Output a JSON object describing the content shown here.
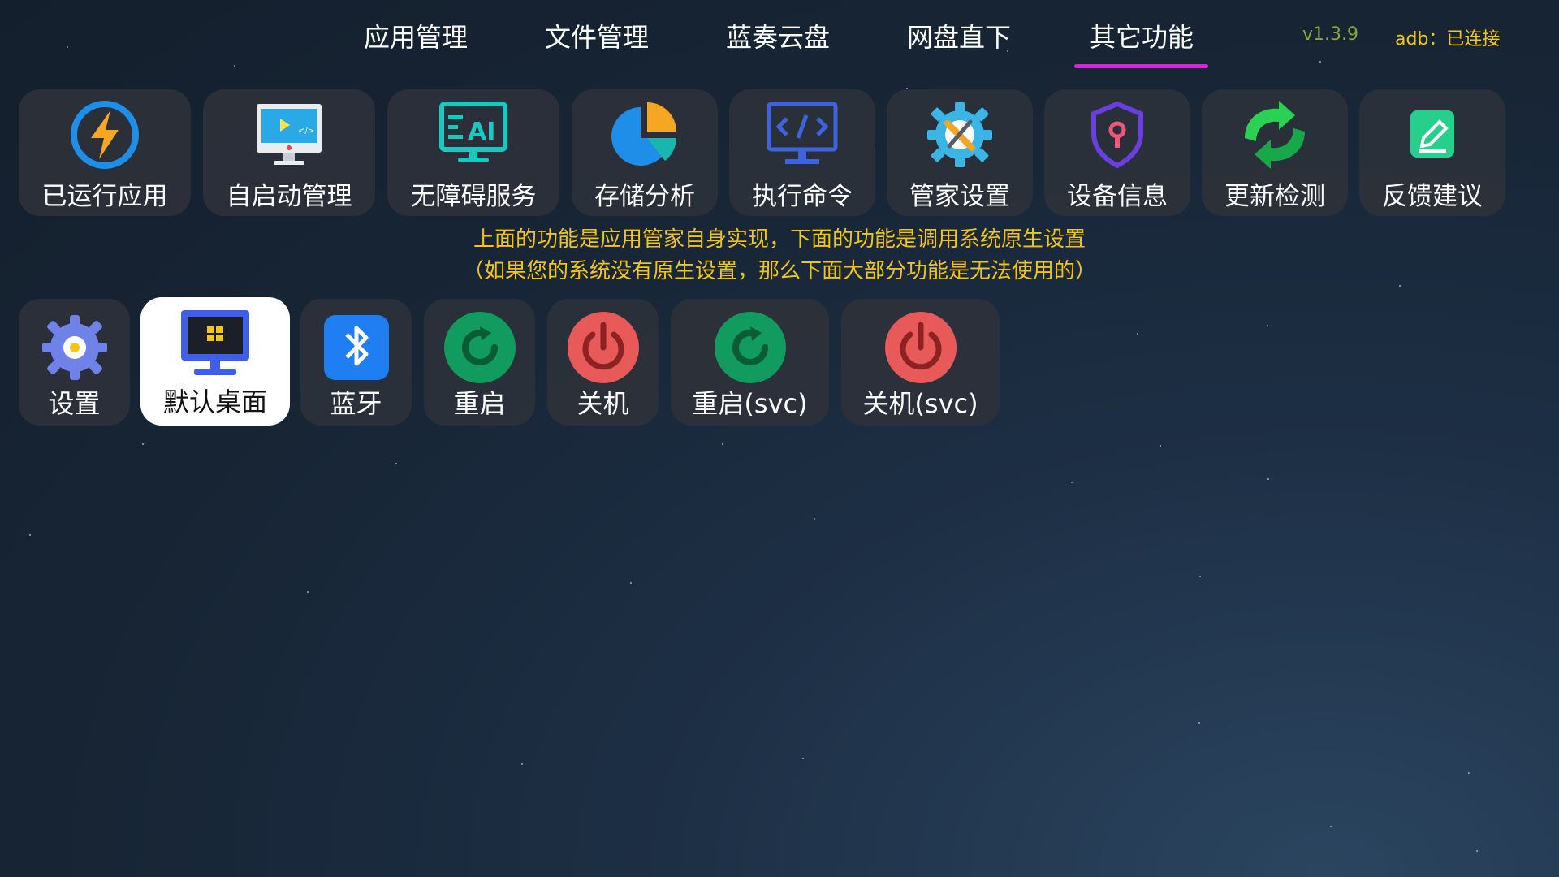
{
  "tabs": [
    {
      "label": "应用管理"
    },
    {
      "label": "文件管理"
    },
    {
      "label": "蓝奏云盘"
    },
    {
      "label": "网盘直下"
    },
    {
      "label": "其它功能",
      "active": true
    }
  ],
  "status": {
    "version": "v1.3.9",
    "adb": "adb：已连接"
  },
  "app_functions": [
    {
      "label": "已运行应用",
      "icon": "lightning-icon"
    },
    {
      "label": "自启动管理",
      "icon": "monitor-code-icon"
    },
    {
      "label": "无障碍服务",
      "icon": "ai-screen-icon"
    },
    {
      "label": "存储分析",
      "icon": "pie-chart-icon"
    },
    {
      "label": "执行命令",
      "icon": "terminal-icon"
    },
    {
      "label": "管家设置",
      "icon": "gear-wrench-icon"
    },
    {
      "label": "设备信息",
      "icon": "shield-icon"
    },
    {
      "label": "更新检测",
      "icon": "refresh-arrows-icon"
    },
    {
      "label": "反馈建议",
      "icon": "edit-icon"
    }
  ],
  "notice": {
    "line1": "上面的功能是应用管家自身实现，下面的功能是调用系统原生设置",
    "line2": "（如果您的系统没有原生设置，那么下面大部分功能是无法使用的）"
  },
  "system_functions": [
    {
      "label": "设置",
      "icon": "settings-icon"
    },
    {
      "label": "默认桌面",
      "icon": "desktop-icon",
      "focused": true
    },
    {
      "label": "蓝牙",
      "icon": "bluetooth-icon"
    },
    {
      "label": "重启",
      "icon": "restart-icon"
    },
    {
      "label": "关机",
      "icon": "power-icon"
    },
    {
      "label": "重启(svc)",
      "icon": "restart-icon"
    },
    {
      "label": "关机(svc)",
      "icon": "power-icon"
    }
  ],
  "colors": {
    "accent_underline": "#e01ee0",
    "notice_text": "#f0c419",
    "version_text": "#8aa33a",
    "adb_text": "#f5c518",
    "restart_green": "#129b5e",
    "power_red": "#e85a5a",
    "bluetooth_blue": "#1e7ef2"
  }
}
